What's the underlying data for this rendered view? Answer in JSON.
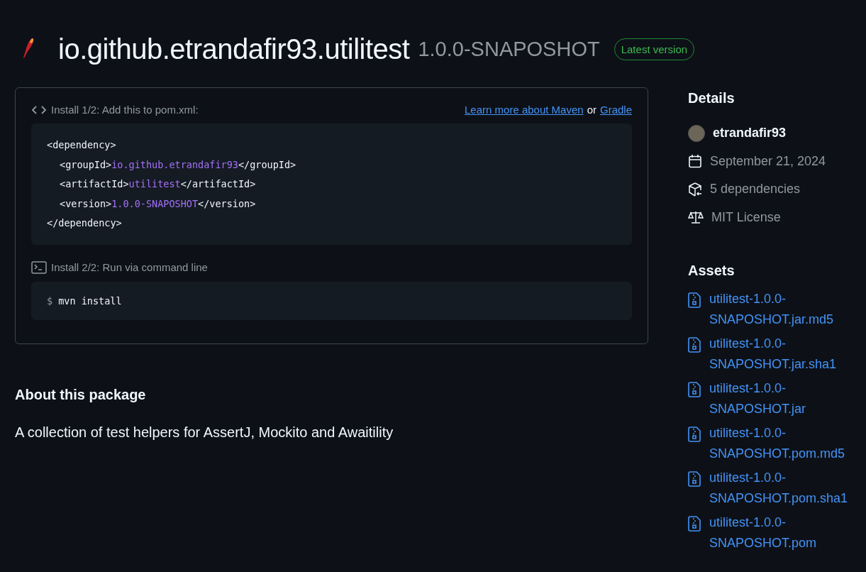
{
  "header": {
    "name": "io.github.etrandafir93.utilitest",
    "version": "1.0.0-SNAPOSHOT",
    "badge": "Latest version"
  },
  "install": [
    {
      "kind": "xml",
      "label": "Install 1/2: Add this to pom.xml:",
      "links": [
        {
          "text": "Learn more about Maven"
        },
        {
          "text": "Gradle"
        }
      ],
      "separator": "or",
      "lines": [
        {
          "indent": false,
          "open": "<dependency>"
        },
        {
          "indent": true,
          "open": "<groupId>",
          "value": "io.github.etrandafir93",
          "close": "</groupId>"
        },
        {
          "indent": true,
          "open": "<artifactId>",
          "value": "utilitest",
          "close": "</artifactId>"
        },
        {
          "indent": true,
          "open": "<version>",
          "value": "1.0.0-SNAPOSHOT",
          "close": "</version>"
        },
        {
          "indent": false,
          "open": "</dependency>"
        }
      ]
    },
    {
      "kind": "terminal",
      "label": "Install 2/2: Run via command line",
      "prompt": "$",
      "command": "mvn install"
    }
  ],
  "about": {
    "title": "About this package",
    "text": "A collection of test helpers for AssertJ, Mockito and Awaitility"
  },
  "details": {
    "title": "Details",
    "author": "etrandafir93",
    "date": "September 21, 2024",
    "dependencies": "5 dependencies",
    "license": "MIT License"
  },
  "assets": {
    "title": "Assets",
    "files": [
      "utilitest-1.0.0-SNAPOSHOT.jar.md5",
      "utilitest-1.0.0-SNAPOSHOT.jar.sha1",
      "utilitest-1.0.0-SNAPOSHOT.jar",
      "utilitest-1.0.0-SNAPOSHOT.pom.md5",
      "utilitest-1.0.0-SNAPOSHOT.pom.sha1",
      "utilitest-1.0.0-SNAPOSHOT.pom"
    ]
  }
}
